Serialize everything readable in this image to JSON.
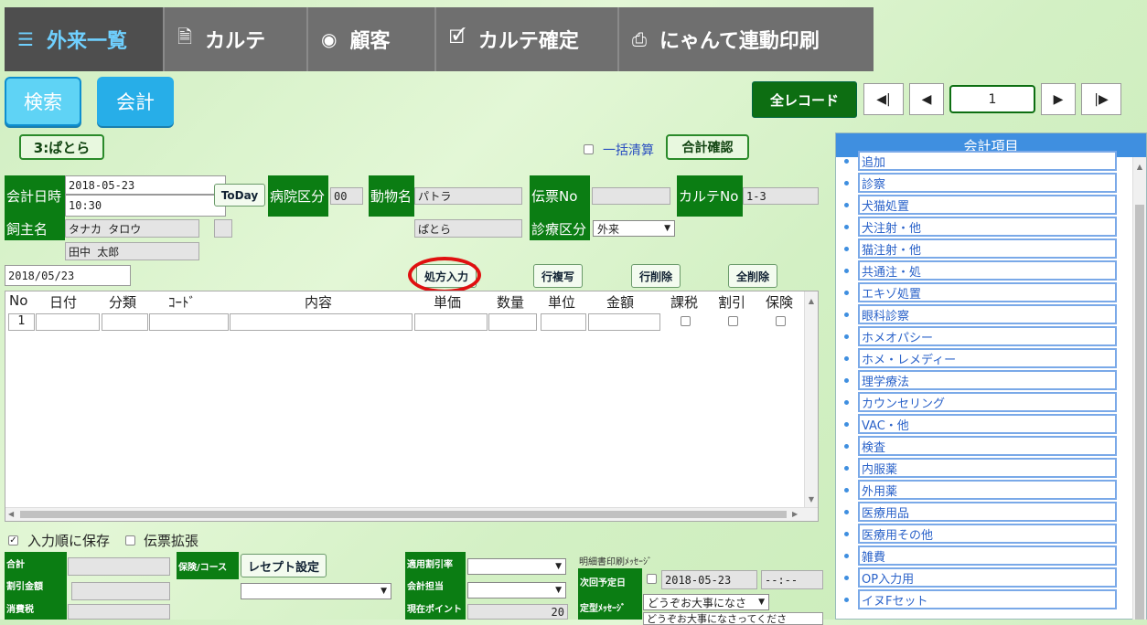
{
  "tabs": [
    {
      "label": "外来一覧",
      "icon": "list-icon",
      "active": true
    },
    {
      "label": "カルテ",
      "icon": "document-icon",
      "active": false
    },
    {
      "label": "顧客",
      "icon": "user-circle-icon",
      "active": false
    },
    {
      "label": "カルテ確定",
      "icon": "document-check-icon",
      "active": false
    },
    {
      "label": "にゃんて連動印刷",
      "icon": "printer-icon",
      "active": false
    }
  ],
  "toolbar": {
    "search": "検索",
    "accounting": "会計",
    "all_records": "全レコード",
    "page": "1"
  },
  "nav": {
    "first": "◀|",
    "prev": "◀",
    "next": "▶",
    "last": "|▶"
  },
  "patient_tag": "3:ぱとら",
  "bulk": {
    "label": "一括清算",
    "confirm": "合計確認"
  },
  "form": {
    "date_label": "会計日時",
    "date": "2018-05-23",
    "time": "10:30",
    "today": "ToDay",
    "hospital_label": "病院区分",
    "hospital_value": "00",
    "animal_label": "動物名",
    "animal_kana": "パトラ",
    "animal_name": "ぱとら",
    "slip_label": "伝票No",
    "slip_value": "",
    "chart_label": "カルテNo",
    "chart_value": "1-3",
    "owner_label": "飼主名",
    "owner_kana": "タナカ タロウ",
    "owner_name": "田中 太郎",
    "diag_label": "診療区分",
    "diag_value": "外来",
    "entry_date": "2018/05/23"
  },
  "actions": {
    "prescribe": "処方入力",
    "copy_row": "行複写",
    "delete_row": "行削除",
    "delete_all": "全削除"
  },
  "grid": {
    "headers": [
      "No",
      "日付",
      "分類",
      "ｺｰﾄﾞ",
      "内容",
      "単価",
      "数量",
      "単位",
      "金額",
      "課税",
      "割引",
      "保険"
    ],
    "row_no": "1"
  },
  "options": {
    "save_order": "入力順に保存",
    "expand_slip": "伝票拡張"
  },
  "summary": {
    "total_label": "合計",
    "discount_label": "割引金額",
    "tax_label": "消費税",
    "insurance_label": "保険/コース",
    "receipt_btn": "レセプト設定",
    "rate_label": "適用割引率",
    "staff_label": "会計担当",
    "points_label": "現在ポイント",
    "points_value": "20",
    "print_msg_title": "明細書印刷ﾒｯｾｰｼﾞ",
    "next_label": "次回予定日",
    "next_date": "2018-05-23",
    "next_time": "--:--",
    "msg_label": "定型ﾒｯｾｰｼﾞ",
    "msg_value": "どうぞお大事になさ",
    "msg_text": "どうぞお大事になさってくださ"
  },
  "panel": {
    "title": "会計項目",
    "items": [
      "追加",
      "診察",
      "犬猫処置",
      "犬注射・他",
      "猫注射・他",
      "共通注・処",
      "エキゾ処置",
      "眼科診察",
      "ホメオパシー",
      "ホメ・レメディー",
      "理学療法",
      "カウンセリング",
      "VAC・他",
      "検査",
      "内服薬",
      "外用薬",
      "医療用品",
      "医療用その他",
      "雑費",
      "OP入力用",
      "イヌFセット"
    ]
  }
}
